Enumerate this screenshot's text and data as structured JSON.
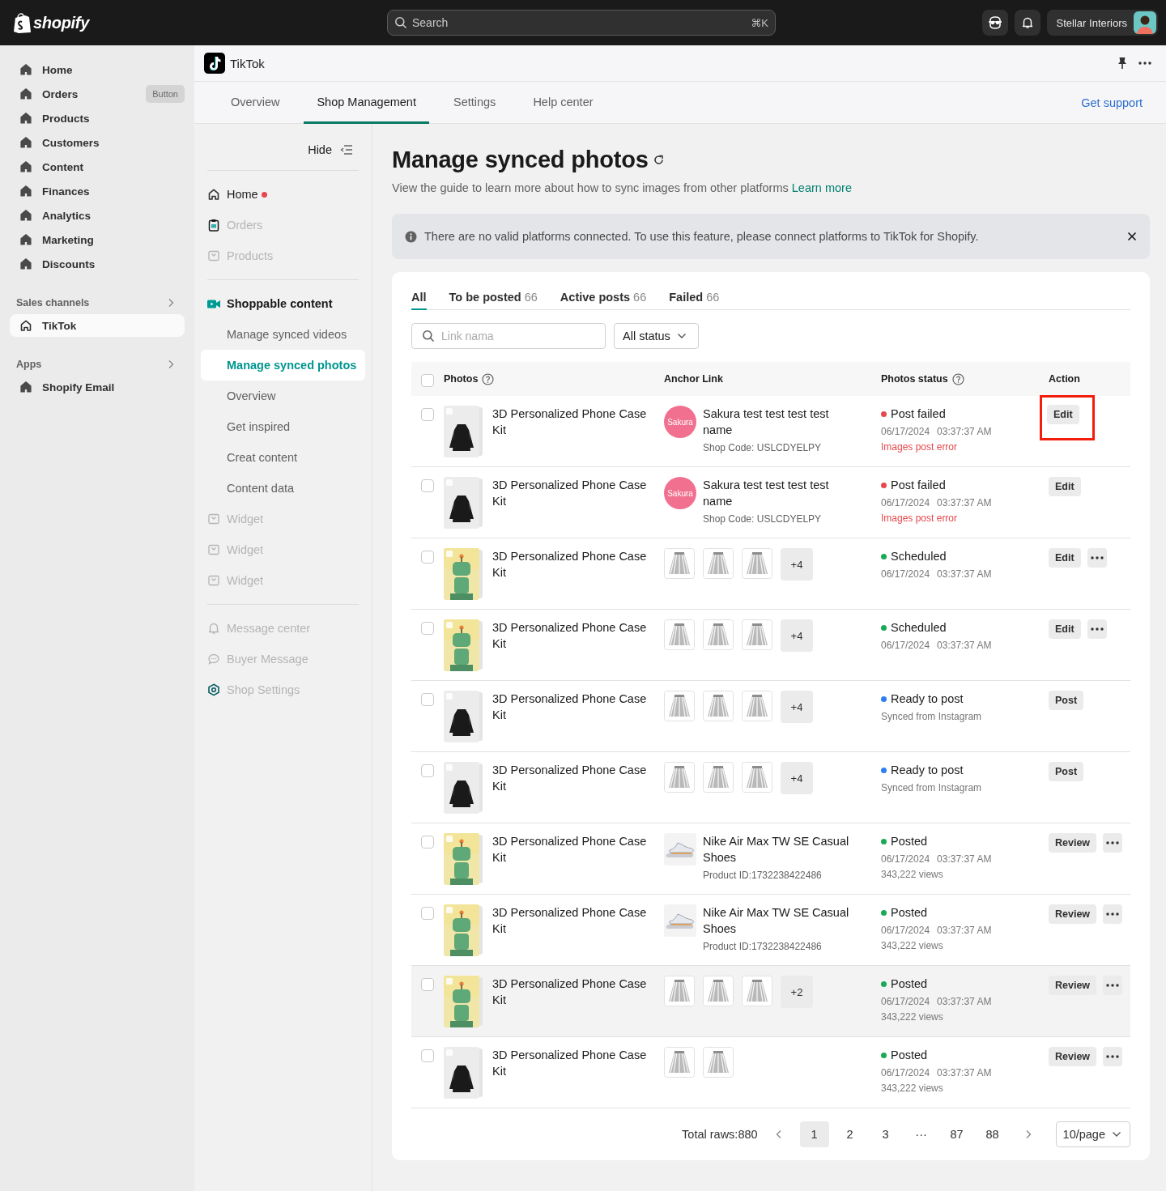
{
  "topbar": {
    "logo": "shopify",
    "search": {
      "placeholder": "Search",
      "shortcut": "⌘K"
    },
    "store": "Stellar Interiors"
  },
  "sidebar": {
    "items": [
      {
        "label": "Home",
        "selected": false
      },
      {
        "label": "Orders",
        "selected": false,
        "badge": "Button"
      },
      {
        "label": "Products",
        "selected": false
      },
      {
        "label": "Customers",
        "selected": false
      },
      {
        "label": "Content",
        "selected": false
      },
      {
        "label": "Finances",
        "selected": false
      },
      {
        "label": "Analytics",
        "selected": false
      },
      {
        "label": "Marketing",
        "selected": false
      },
      {
        "label": "Discounts",
        "selected": false
      }
    ],
    "sections": [
      {
        "title": "Sales channels",
        "items": [
          {
            "label": "TikTok",
            "selected": true
          }
        ]
      },
      {
        "title": "Apps",
        "items": [
          {
            "label": "Shopify Email",
            "selected": false
          }
        ]
      }
    ]
  },
  "app_header": {
    "title": "TikTok"
  },
  "tabs": [
    {
      "label": "Overview",
      "selected": false
    },
    {
      "label": "Shop Management",
      "selected": true
    },
    {
      "label": "Settings",
      "selected": false
    },
    {
      "label": "Help center",
      "selected": false
    }
  ],
  "support_link": "Get support",
  "subnav": {
    "hide": "Hide",
    "groups": [
      {
        "items": [
          {
            "label": "Home",
            "kind": "link",
            "dot": true,
            "disabled": false,
            "selected": false
          },
          {
            "label": "Orders",
            "kind": "link",
            "dot": false,
            "disabled": true,
            "selected": false
          },
          {
            "label": "Products",
            "kind": "link",
            "dot": false,
            "disabled": true,
            "selected": false
          }
        ]
      },
      {
        "items": [
          {
            "label": "Shoppable content",
            "kind": "heading",
            "dot": false,
            "disabled": false,
            "selected": false
          },
          {
            "label": "Manage synced videos",
            "kind": "sub",
            "dot": false,
            "disabled": false,
            "selected": false
          },
          {
            "label": "Manage synced photos",
            "kind": "sub",
            "dot": false,
            "disabled": false,
            "selected": true
          },
          {
            "label": "Overview",
            "kind": "sub",
            "dot": false,
            "disabled": false,
            "selected": false
          },
          {
            "label": "Get inspired",
            "kind": "sub",
            "dot": false,
            "disabled": false,
            "selected": false
          },
          {
            "label": "Creat content",
            "kind": "sub",
            "dot": false,
            "disabled": false,
            "selected": false
          },
          {
            "label": "Content data",
            "kind": "sub",
            "dot": false,
            "disabled": false,
            "selected": false
          },
          {
            "label": "Widget",
            "kind": "link",
            "dot": false,
            "disabled": true,
            "selected": false
          },
          {
            "label": "Widget",
            "kind": "link",
            "dot": false,
            "disabled": true,
            "selected": false
          },
          {
            "label": "Widget",
            "kind": "link",
            "dot": false,
            "disabled": true,
            "selected": false
          }
        ]
      },
      {
        "items": [
          {
            "label": "Message center",
            "kind": "link",
            "dot": false,
            "disabled": true,
            "selected": false
          },
          {
            "label": "Buyer Message",
            "kind": "link",
            "dot": false,
            "disabled": true,
            "selected": false
          },
          {
            "label": "Shop Settings",
            "kind": "link",
            "dot": false,
            "disabled": true,
            "selected": false
          }
        ]
      }
    ]
  },
  "page": {
    "title": "Manage synced photos",
    "subtitle": "View the guide to learn more about how to sync images from other platforms",
    "learn_more": "Learn more"
  },
  "banner": {
    "text": "There are no valid platforms connected. To use this feature, please connect platforms to TikTok for Shopify."
  },
  "filter_tabs": [
    {
      "label": "All",
      "selected": true
    },
    {
      "label": "To be posted",
      "count": "66",
      "selected": false
    },
    {
      "label": "Active posts",
      "count": "66",
      "selected": false
    },
    {
      "label": "Failed",
      "count": "66",
      "selected": false
    }
  ],
  "search": {
    "placeholder": "Link nama"
  },
  "status_filter": "All status",
  "table": {
    "select_all": {
      "checked": false
    },
    "columns": [
      {
        "label": "Photos",
        "help": true
      },
      {
        "label": "Anchor Link",
        "help": false
      },
      {
        "label": "Photos status",
        "help": true
      },
      {
        "label": "Action",
        "help": false
      }
    ],
    "rows": [
      {
        "checked": false,
        "hovered": false,
        "photo": {
          "kind": "picture"
        },
        "name": "3D Personalized Phone Case Kit",
        "anchor": {
          "kind": "shop",
          "logo": "Sakura",
          "name": "Sakura test test test test name",
          "meta": "Shop Code: USLCDYELPY"
        },
        "status": {
          "label": "Post failed",
          "color": "#e5484d",
          "date": "06/17/2024",
          "time": "03:37:37 AM",
          "error": "Images post error"
        },
        "actions": [
          {
            "kind": "button",
            "label": "Edit",
            "highlighted": true
          }
        ]
      },
      {
        "checked": false,
        "hovered": false,
        "photo": {
          "kind": "picture"
        },
        "name": "3D Personalized Phone Case Kit",
        "anchor": {
          "kind": "shop",
          "logo": "Sakura",
          "name": "Sakura test test test test name",
          "meta": "Shop Code: USLCDYELPY"
        },
        "status": {
          "label": "Post failed",
          "color": "#e5484d",
          "date": "06/17/2024",
          "time": "03:37:37 AM",
          "error": "Images post error"
        },
        "actions": [
          {
            "kind": "button",
            "label": "Edit",
            "highlighted": false
          }
        ]
      },
      {
        "checked": false,
        "hovered": false,
        "photo": {
          "kind": "picture"
        },
        "name": "3D Personalized Phone Case Kit",
        "anchor": {
          "kind": "images",
          "images": [
            {
              "kind": "picture"
            },
            {
              "kind": "picture"
            },
            {
              "kind": "picture"
            }
          ],
          "more": "+4"
        },
        "status": {
          "label": "Scheduled",
          "color": "#1aaa55",
          "date": "06/17/2024",
          "time": "03:37:37 AM"
        },
        "actions": [
          {
            "kind": "button",
            "label": "Edit",
            "highlighted": false
          },
          {
            "kind": "more"
          }
        ]
      },
      {
        "checked": false,
        "hovered": false,
        "photo": {
          "kind": "picture"
        },
        "name": "3D Personalized Phone Case Kit",
        "anchor": {
          "kind": "images",
          "images": [
            {
              "kind": "picture"
            },
            {
              "kind": "picture"
            },
            {
              "kind": "picture"
            }
          ],
          "more": "+4"
        },
        "status": {
          "label": "Scheduled",
          "color": "#1aaa55",
          "date": "06/17/2024",
          "time": "03:37:37 AM"
        },
        "actions": [
          {
            "kind": "button",
            "label": "Edit",
            "highlighted": false
          },
          {
            "kind": "more"
          }
        ]
      },
      {
        "checked": false,
        "hovered": false,
        "photo": {
          "kind": "picture"
        },
        "name": "3D Personalized Phone Case Kit",
        "anchor": {
          "kind": "images",
          "images": [
            {
              "kind": "picture"
            },
            {
              "kind": "picture"
            },
            {
              "kind": "picture"
            }
          ],
          "more": "+4"
        },
        "status": {
          "label": "Ready to post",
          "color": "#2f7ff0",
          "detail": "Synced from Instagram"
        },
        "actions": [
          {
            "kind": "button",
            "label": "Post",
            "highlighted": false
          }
        ]
      },
      {
        "checked": false,
        "hovered": false,
        "photo": {
          "kind": "picture"
        },
        "name": "3D Personalized Phone Case Kit",
        "anchor": {
          "kind": "images",
          "images": [
            {
              "kind": "picture"
            },
            {
              "kind": "picture"
            },
            {
              "kind": "picture"
            }
          ],
          "more": "+4"
        },
        "status": {
          "label": "Ready to post",
          "color": "#2f7ff0",
          "detail": "Synced from Instagram"
        },
        "actions": [
          {
            "kind": "button",
            "label": "Post",
            "highlighted": false
          }
        ]
      },
      {
        "checked": false,
        "hovered": false,
        "photo": {
          "kind": "picture"
        },
        "name": "3D Personalized Phone Case Kit",
        "anchor": {
          "kind": "product",
          "name": "Nike Air Max TW SE Casual Shoes",
          "meta": "Product ID:1732238422486"
        },
        "status": {
          "label": "Posted",
          "color": "#1aaa55",
          "date": "06/17/2024",
          "time": "03:37:37 AM",
          "detail": "343,222 views"
        },
        "actions": [
          {
            "kind": "button",
            "label": "Review",
            "highlighted": false
          },
          {
            "kind": "more"
          }
        ]
      },
      {
        "checked": false,
        "hovered": false,
        "photo": {
          "kind": "picture"
        },
        "name": "3D Personalized Phone Case Kit",
        "anchor": {
          "kind": "product",
          "name": "Nike Air Max TW SE Casual Shoes",
          "meta": "Product ID:1732238422486"
        },
        "status": {
          "label": "Posted",
          "color": "#1aaa55",
          "date": "06/17/2024",
          "time": "03:37:37 AM",
          "detail": "343,222 views"
        },
        "actions": [
          {
            "kind": "button",
            "label": "Review",
            "highlighted": false
          },
          {
            "kind": "more"
          }
        ]
      },
      {
        "checked": false,
        "hovered": true,
        "photo": {
          "kind": "picture"
        },
        "name": "3D Personalized Phone Case Kit",
        "anchor": {
          "kind": "images",
          "images": [
            {
              "kind": "picture"
            },
            {
              "kind": "picture"
            },
            {
              "kind": "picture"
            }
          ],
          "more": "+2"
        },
        "status": {
          "label": "Posted",
          "color": "#1aaa55",
          "date": "06/17/2024",
          "time": "03:37:37 AM",
          "detail": "343,222 views"
        },
        "actions": [
          {
            "kind": "button",
            "label": "Review",
            "highlighted": false
          },
          {
            "kind": "more"
          }
        ]
      },
      {
        "checked": false,
        "hovered": false,
        "photo": {
          "kind": "picture"
        },
        "name": "3D Personalized Phone Case Kit",
        "anchor": {
          "kind": "images",
          "images": [
            {
              "kind": "picture"
            },
            {
              "kind": "picture"
            }
          ]
        },
        "status": {
          "label": "Posted",
          "color": "#1aaa55",
          "date": "06/17/2024",
          "time": "03:37:37 AM",
          "detail": "343,222 views"
        },
        "actions": [
          {
            "kind": "button",
            "label": "Review",
            "highlighted": false
          },
          {
            "kind": "more"
          }
        ]
      }
    ]
  },
  "pagination": {
    "total": "Total raws:880",
    "pages": [
      {
        "label": "1",
        "selected": true
      },
      {
        "label": "2",
        "selected": false
      },
      {
        "label": "3",
        "selected": false
      },
      {
        "label": "···",
        "selected": false
      },
      {
        "label": "87",
        "selected": false
      },
      {
        "label": "88",
        "selected": false
      }
    ],
    "page_size": "10/page"
  }
}
